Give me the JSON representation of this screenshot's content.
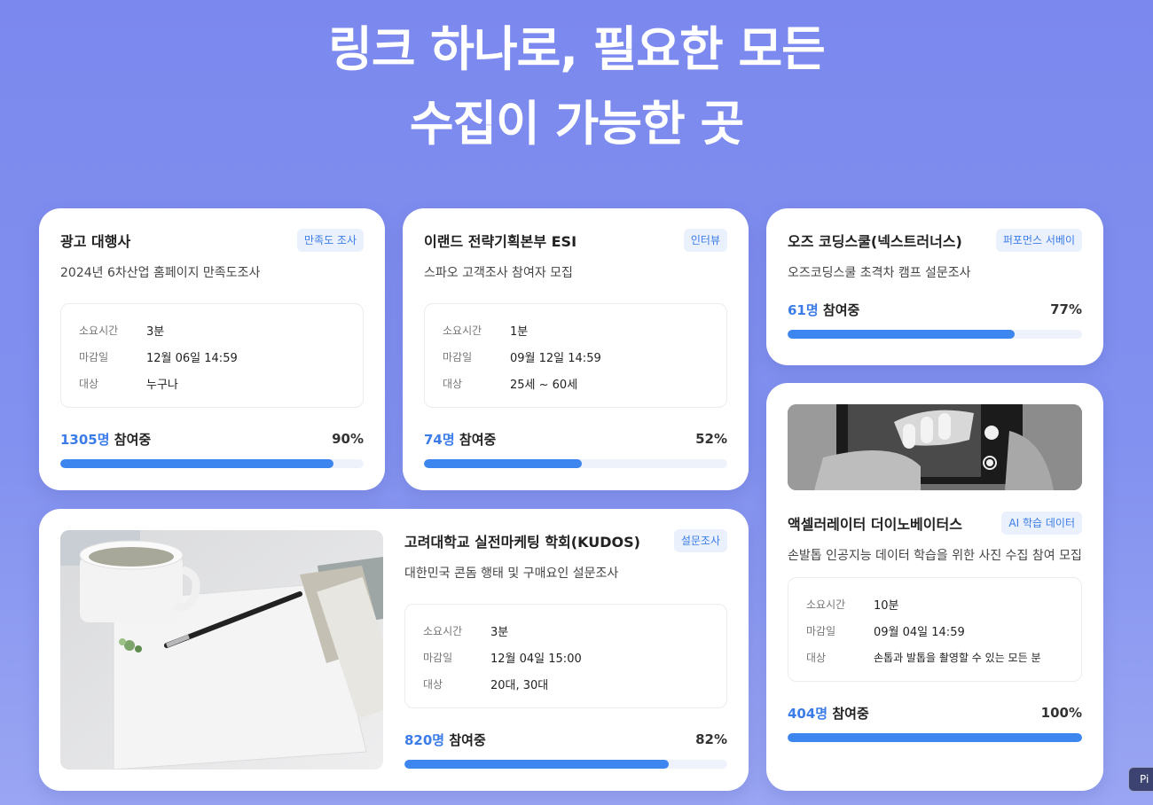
{
  "hero": {
    "line1": "링크 하나로, 필요한 모든",
    "line2": "수집이 가능한 곳"
  },
  "labels": {
    "time": "소요시간",
    "deadline": "마감일",
    "target": "대상",
    "participating": "참여중"
  },
  "cards": [
    {
      "title": "광고 대행사",
      "badge": "만족도 조사",
      "subtitle": "2024년 6차산업 홈페이지 만족도조사",
      "time": "3분",
      "deadline": "12월 06일 14:59",
      "target": "누구나",
      "count": "1305명",
      "percent": "90%",
      "progress": 0.9
    },
    {
      "title": "이랜드 전략기획본부 ESI",
      "badge": "인터뷰",
      "subtitle": "스파오 고객조사 참여자 모집",
      "time": "1분",
      "deadline": "09월 12일 14:59",
      "target": "25세 ~ 60세",
      "count": "74명",
      "percent": "52%",
      "progress": 0.52
    },
    {
      "title": "오즈 코딩스쿨(넥스트러너스)",
      "badge": "퍼포먼스 서베이",
      "subtitle": "오즈코딩스쿨 초격차 캠프 설문조사",
      "count": "61명",
      "percent": "77%",
      "progress": 0.77
    },
    {
      "title": "고려대학교 실전마케팅 학회(KUDOS)",
      "badge": "설문조사",
      "subtitle": "대한민국 콘돔 행태 및 구매요인 설문조사",
      "time": "3분",
      "deadline": "12월 04일 15:00",
      "target": "20대, 30대",
      "count": "820명",
      "percent": "82%",
      "progress": 0.82
    },
    {
      "title": "액셀러레이터 더이노베이터스",
      "badge": "AI 학습 데이터",
      "subtitle": "손발톱 인공지능 데이터 학습을 위한 사진 수집 참여 모집",
      "time": "10분",
      "deadline": "09월 04일 14:59",
      "target": "손톱과 발톱을 촬영할 수 있는 모든 분",
      "count": "404명",
      "percent": "100%",
      "progress": 1.0
    }
  ],
  "corner_button": "Pi",
  "colors": {
    "accent": "#3d85ef",
    "badge_bg": "#eaf1fc",
    "background": "#7b88ee"
  }
}
